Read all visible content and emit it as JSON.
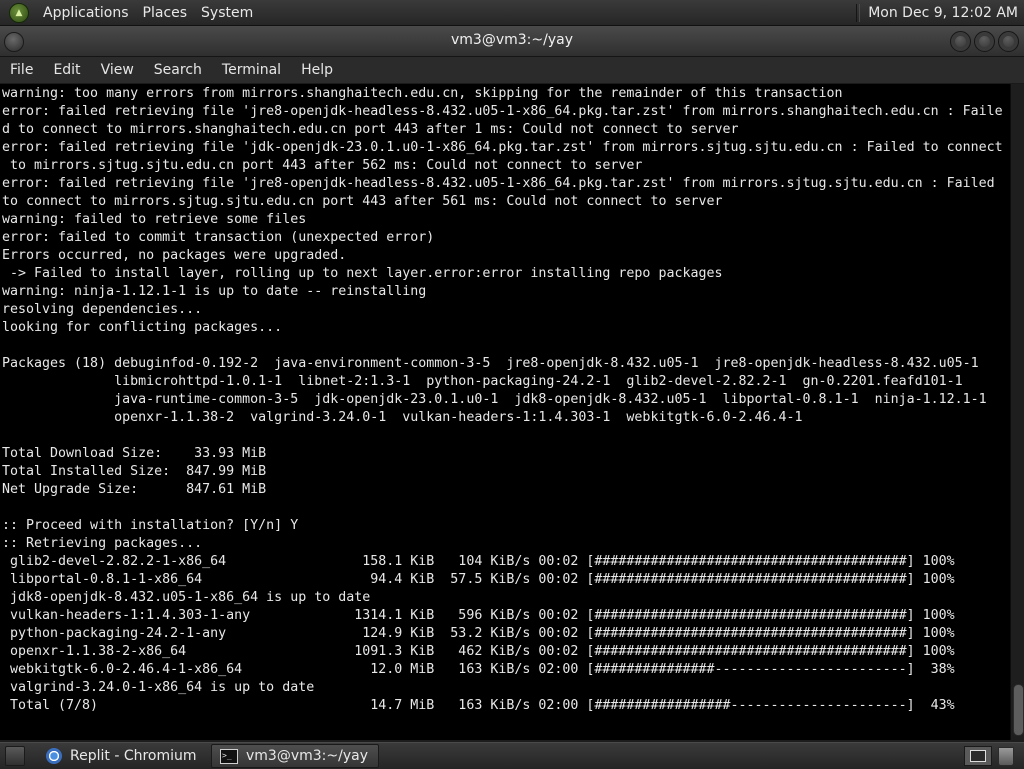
{
  "top_panel": {
    "menus": [
      "Applications",
      "Places",
      "System"
    ],
    "clock": "Mon Dec  9, 12:02 AM"
  },
  "window": {
    "title": "vm3@vm3:~/yay"
  },
  "menubar": {
    "items": [
      "File",
      "Edit",
      "View",
      "Search",
      "Terminal",
      "Help"
    ]
  },
  "terminal": {
    "lines": [
      "warning: too many errors from mirrors.shanghaitech.edu.cn, skipping for the remainder of this transaction",
      "error: failed retrieving file 'jre8-openjdk-headless-8.432.u05-1-x86_64.pkg.tar.zst' from mirrors.shanghaitech.edu.cn : Faile",
      "d to connect to mirrors.shanghaitech.edu.cn port 443 after 1 ms: Could not connect to server",
      "error: failed retrieving file 'jdk-openjdk-23.0.1.u0-1-x86_64.pkg.tar.zst' from mirrors.sjtug.sjtu.edu.cn : Failed to connect",
      " to mirrors.sjtug.sjtu.edu.cn port 443 after 562 ms: Could not connect to server",
      "error: failed retrieving file 'jre8-openjdk-headless-8.432.u05-1-x86_64.pkg.tar.zst' from mirrors.sjtug.sjtu.edu.cn : Failed",
      "to connect to mirrors.sjtug.sjtu.edu.cn port 443 after 561 ms: Could not connect to server",
      "warning: failed to retrieve some files",
      "error: failed to commit transaction (unexpected error)",
      "Errors occurred, no packages were upgraded.",
      " -> Failed to install layer, rolling up to next layer.error:error installing repo packages",
      "warning: ninja-1.12.1-1 is up to date -- reinstalling",
      "resolving dependencies...",
      "looking for conflicting packages...",
      "",
      "Packages (18) debuginfod-0.192-2  java-environment-common-3-5  jre8-openjdk-8.432.u05-1  jre8-openjdk-headless-8.432.u05-1",
      "              libmicrohttpd-1.0.1-1  libnet-2:1.3-1  python-packaging-24.2-1  glib2-devel-2.82.2-1  gn-0.2201.feafd101-1",
      "              java-runtime-common-3-5  jdk-openjdk-23.0.1.u0-1  jdk8-openjdk-8.432.u05-1  libportal-0.8.1-1  ninja-1.12.1-1",
      "              openxr-1.1.38-2  valgrind-3.24.0-1  vulkan-headers-1:1.4.303-1  webkitgtk-6.0-2.46.4-1",
      "",
      "Total Download Size:    33.93 MiB",
      "Total Installed Size:  847.99 MiB",
      "Net Upgrade Size:      847.61 MiB",
      "",
      ":: Proceed with installation? [Y/n] Y",
      ":: Retrieving packages...",
      " glib2-devel-2.82.2-1-x86_64                 158.1 KiB   104 KiB/s 00:02 [#######################################] 100%",
      " libportal-0.8.1-1-x86_64                     94.4 KiB  57.5 KiB/s 00:02 [#######################################] 100%",
      " jdk8-openjdk-8.432.u05-1-x86_64 is up to date",
      " vulkan-headers-1:1.4.303-1-any             1314.1 KiB   596 KiB/s 00:02 [#######################################] 100%",
      " python-packaging-24.2-1-any                 124.9 KiB  53.2 KiB/s 00:02 [#######################################] 100%",
      " openxr-1.1.38-2-x86_64                     1091.3 KiB   462 KiB/s 00:02 [#######################################] 100%",
      " webkitgtk-6.0-2.46.4-1-x86_64                12.0 MiB   163 KiB/s 02:00 [###############------------------------]  38%",
      " valgrind-3.24.0-1-x86_64 is up to date",
      " Total (7/8)                                  14.7 MiB   163 KiB/s 02:00 [#################----------------------]  43%"
    ]
  },
  "taskbar": {
    "tasks": [
      "Replit - Chromium",
      "vm3@vm3:~/yay"
    ]
  }
}
